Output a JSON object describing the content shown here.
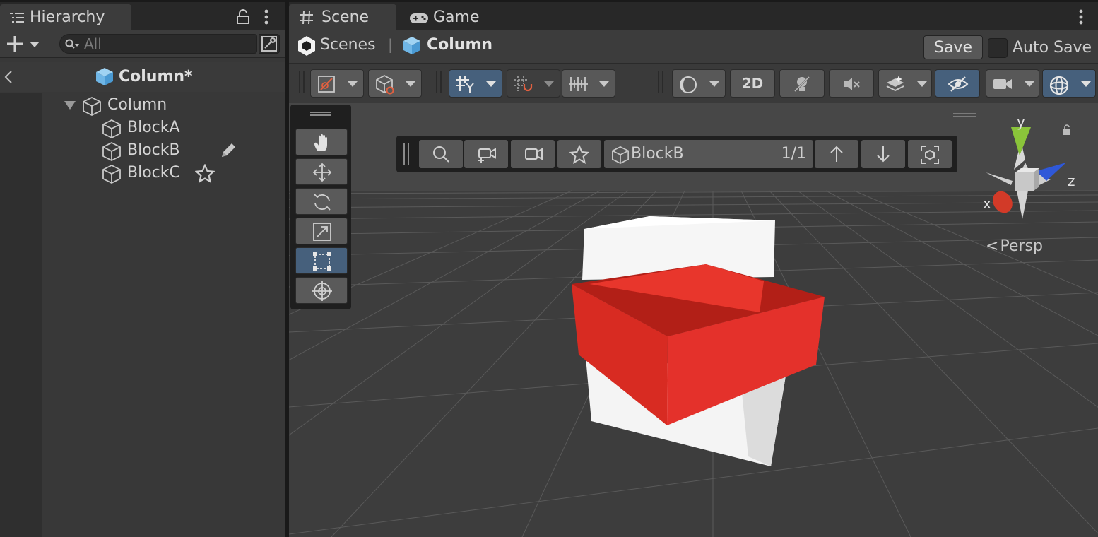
{
  "hierarchy": {
    "tab_label": "Hierarchy",
    "search_placeholder": "All",
    "scene_name": "Column*",
    "root": {
      "label": "Column",
      "expanded": true
    },
    "children": [
      {
        "label": "BlockA",
        "badge": ""
      },
      {
        "label": "BlockB",
        "badge": "pencil-icon"
      },
      {
        "label": "BlockC",
        "badge": "star-icon"
      }
    ]
  },
  "tabs": {
    "scene": "Scene",
    "game": "Game"
  },
  "breadcrumb": {
    "scenes": "Scenes",
    "separator": "|",
    "current": "Column"
  },
  "save": {
    "label": "Save",
    "auto_save_label": "Auto Save",
    "auto_save_checked": false
  },
  "toolbar": {
    "mode_2d": "2D",
    "active_buttons": [
      "grid-snapping",
      "scene-visibility",
      "gizmos"
    ]
  },
  "tools": [
    "hand-tool",
    "move-tool",
    "rotate-tool",
    "scale-tool",
    "rect-tool",
    "transform-tool"
  ],
  "active_tool": "rect-tool",
  "overlay_search": {
    "object": "BlockB",
    "count": "1/1"
  },
  "gizmo": {
    "x": "x",
    "y": "y",
    "z": "z"
  },
  "projection_label": "Persp",
  "colors": {
    "accent_active": "#46607c",
    "selected_object": "#e4312b",
    "axis_x": "#d23a28",
    "axis_y": "#8ac43a",
    "axis_z": "#2f58d8",
    "scene_icon": "#6fb6e6"
  }
}
